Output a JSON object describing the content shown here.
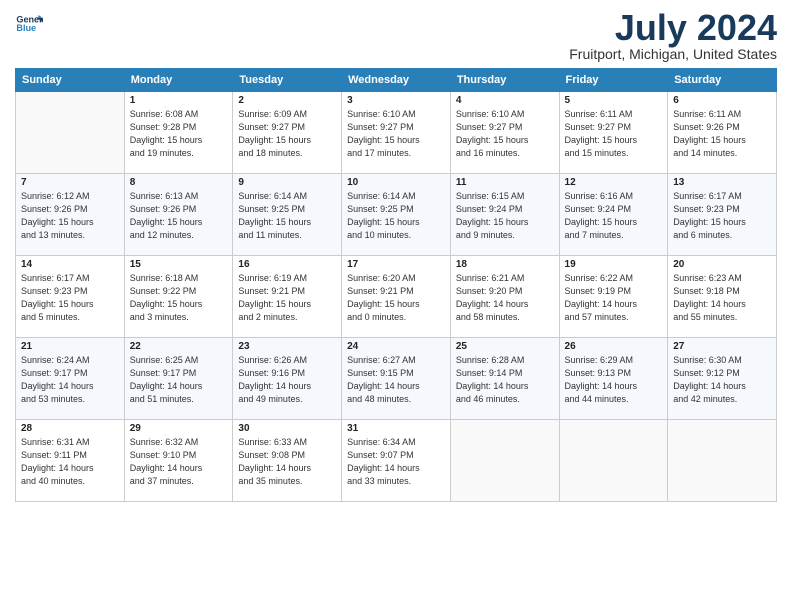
{
  "logo": {
    "line1": "General",
    "line2": "Blue"
  },
  "title": "July 2024",
  "subtitle": "Fruitport, Michigan, United States",
  "days_of_week": [
    "Sunday",
    "Monday",
    "Tuesday",
    "Wednesday",
    "Thursday",
    "Friday",
    "Saturday"
  ],
  "weeks": [
    [
      {
        "day": "",
        "detail": ""
      },
      {
        "day": "1",
        "detail": "Sunrise: 6:08 AM\nSunset: 9:28 PM\nDaylight: 15 hours\nand 19 minutes."
      },
      {
        "day": "2",
        "detail": "Sunrise: 6:09 AM\nSunset: 9:27 PM\nDaylight: 15 hours\nand 18 minutes."
      },
      {
        "day": "3",
        "detail": "Sunrise: 6:10 AM\nSunset: 9:27 PM\nDaylight: 15 hours\nand 17 minutes."
      },
      {
        "day": "4",
        "detail": "Sunrise: 6:10 AM\nSunset: 9:27 PM\nDaylight: 15 hours\nand 16 minutes."
      },
      {
        "day": "5",
        "detail": "Sunrise: 6:11 AM\nSunset: 9:27 PM\nDaylight: 15 hours\nand 15 minutes."
      },
      {
        "day": "6",
        "detail": "Sunrise: 6:11 AM\nSunset: 9:26 PM\nDaylight: 15 hours\nand 14 minutes."
      }
    ],
    [
      {
        "day": "7",
        "detail": "Sunrise: 6:12 AM\nSunset: 9:26 PM\nDaylight: 15 hours\nand 13 minutes."
      },
      {
        "day": "8",
        "detail": "Sunrise: 6:13 AM\nSunset: 9:26 PM\nDaylight: 15 hours\nand 12 minutes."
      },
      {
        "day": "9",
        "detail": "Sunrise: 6:14 AM\nSunset: 9:25 PM\nDaylight: 15 hours\nand 11 minutes."
      },
      {
        "day": "10",
        "detail": "Sunrise: 6:14 AM\nSunset: 9:25 PM\nDaylight: 15 hours\nand 10 minutes."
      },
      {
        "day": "11",
        "detail": "Sunrise: 6:15 AM\nSunset: 9:24 PM\nDaylight: 15 hours\nand 9 minutes."
      },
      {
        "day": "12",
        "detail": "Sunrise: 6:16 AM\nSunset: 9:24 PM\nDaylight: 15 hours\nand 7 minutes."
      },
      {
        "day": "13",
        "detail": "Sunrise: 6:17 AM\nSunset: 9:23 PM\nDaylight: 15 hours\nand 6 minutes."
      }
    ],
    [
      {
        "day": "14",
        "detail": "Sunrise: 6:17 AM\nSunset: 9:23 PM\nDaylight: 15 hours\nand 5 minutes."
      },
      {
        "day": "15",
        "detail": "Sunrise: 6:18 AM\nSunset: 9:22 PM\nDaylight: 15 hours\nand 3 minutes."
      },
      {
        "day": "16",
        "detail": "Sunrise: 6:19 AM\nSunset: 9:21 PM\nDaylight: 15 hours\nand 2 minutes."
      },
      {
        "day": "17",
        "detail": "Sunrise: 6:20 AM\nSunset: 9:21 PM\nDaylight: 15 hours\nand 0 minutes."
      },
      {
        "day": "18",
        "detail": "Sunrise: 6:21 AM\nSunset: 9:20 PM\nDaylight: 14 hours\nand 58 minutes."
      },
      {
        "day": "19",
        "detail": "Sunrise: 6:22 AM\nSunset: 9:19 PM\nDaylight: 14 hours\nand 57 minutes."
      },
      {
        "day": "20",
        "detail": "Sunrise: 6:23 AM\nSunset: 9:18 PM\nDaylight: 14 hours\nand 55 minutes."
      }
    ],
    [
      {
        "day": "21",
        "detail": "Sunrise: 6:24 AM\nSunset: 9:17 PM\nDaylight: 14 hours\nand 53 minutes."
      },
      {
        "day": "22",
        "detail": "Sunrise: 6:25 AM\nSunset: 9:17 PM\nDaylight: 14 hours\nand 51 minutes."
      },
      {
        "day": "23",
        "detail": "Sunrise: 6:26 AM\nSunset: 9:16 PM\nDaylight: 14 hours\nand 49 minutes."
      },
      {
        "day": "24",
        "detail": "Sunrise: 6:27 AM\nSunset: 9:15 PM\nDaylight: 14 hours\nand 48 minutes."
      },
      {
        "day": "25",
        "detail": "Sunrise: 6:28 AM\nSunset: 9:14 PM\nDaylight: 14 hours\nand 46 minutes."
      },
      {
        "day": "26",
        "detail": "Sunrise: 6:29 AM\nSunset: 9:13 PM\nDaylight: 14 hours\nand 44 minutes."
      },
      {
        "day": "27",
        "detail": "Sunrise: 6:30 AM\nSunset: 9:12 PM\nDaylight: 14 hours\nand 42 minutes."
      }
    ],
    [
      {
        "day": "28",
        "detail": "Sunrise: 6:31 AM\nSunset: 9:11 PM\nDaylight: 14 hours\nand 40 minutes."
      },
      {
        "day": "29",
        "detail": "Sunrise: 6:32 AM\nSunset: 9:10 PM\nDaylight: 14 hours\nand 37 minutes."
      },
      {
        "day": "30",
        "detail": "Sunrise: 6:33 AM\nSunset: 9:08 PM\nDaylight: 14 hours\nand 35 minutes."
      },
      {
        "day": "31",
        "detail": "Sunrise: 6:34 AM\nSunset: 9:07 PM\nDaylight: 14 hours\nand 33 minutes."
      },
      {
        "day": "",
        "detail": ""
      },
      {
        "day": "",
        "detail": ""
      },
      {
        "day": "",
        "detail": ""
      }
    ]
  ]
}
